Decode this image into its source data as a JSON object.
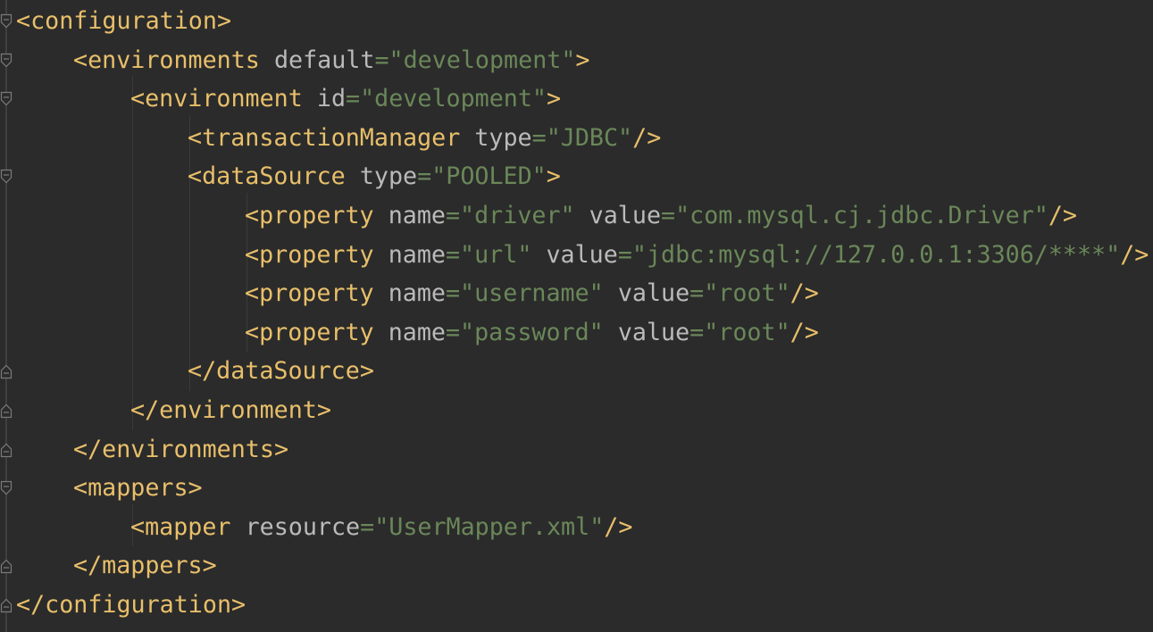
{
  "editor": {
    "language": "xml",
    "colors": {
      "background": "#2b2b2b",
      "tag": "#e8bf6a",
      "attribute": "#bababa",
      "value": "#6a8759"
    },
    "lines": [
      {
        "indent": 0,
        "open": "<configuration",
        "close": ">"
      },
      {
        "indent": 1,
        "open": "<environments",
        "attrs": [
          {
            "name": "default",
            "value": "\"development\""
          }
        ],
        "close": ">"
      },
      {
        "indent": 2,
        "open": "<environment",
        "attrs": [
          {
            "name": "id",
            "value": "\"development\""
          }
        ],
        "close": ">"
      },
      {
        "indent": 3,
        "open": "<transactionManager",
        "attrs": [
          {
            "name": "type",
            "value": "\"JDBC\""
          }
        ],
        "close": "/>"
      },
      {
        "indent": 3,
        "open": "<dataSource",
        "attrs": [
          {
            "name": "type",
            "value": "\"POOLED\""
          }
        ],
        "close": ">"
      },
      {
        "indent": 4,
        "open": "<property",
        "attrs": [
          {
            "name": "name",
            "value": "\"driver\""
          },
          {
            "name": "value",
            "value": "\"com.mysql.cj.jdbc.Driver\""
          }
        ],
        "close": "/>"
      },
      {
        "indent": 4,
        "open": "<property",
        "attrs": [
          {
            "name": "name",
            "value": "\"url\""
          },
          {
            "name": "value",
            "value": "\"jdbc:mysql://127.0.0.1:3306/****\""
          }
        ],
        "close": "/>"
      },
      {
        "indent": 4,
        "open": "<property",
        "attrs": [
          {
            "name": "name",
            "value": "\"username\""
          },
          {
            "name": "value",
            "value": "\"root\""
          }
        ],
        "close": "/>"
      },
      {
        "indent": 4,
        "open": "<property",
        "attrs": [
          {
            "name": "name",
            "value": "\"password\""
          },
          {
            "name": "value",
            "value": "\"root\""
          }
        ],
        "close": "/>"
      },
      {
        "indent": 3,
        "open": "</dataSource",
        "close": ">"
      },
      {
        "indent": 2,
        "open": "</environment",
        "close": ">"
      },
      {
        "indent": 1,
        "open": "</environments",
        "close": ">"
      },
      {
        "indent": 1,
        "open": "<mappers",
        "close": ">"
      },
      {
        "indent": 2,
        "open": "<mapper",
        "attrs": [
          {
            "name": "resource",
            "value": "\"UserMapper.xml\""
          }
        ],
        "close": "/>"
      },
      {
        "indent": 1,
        "open": "</mappers",
        "close": ">"
      },
      {
        "indent": 0,
        "open": "</configuration",
        "close": ">"
      }
    ]
  }
}
